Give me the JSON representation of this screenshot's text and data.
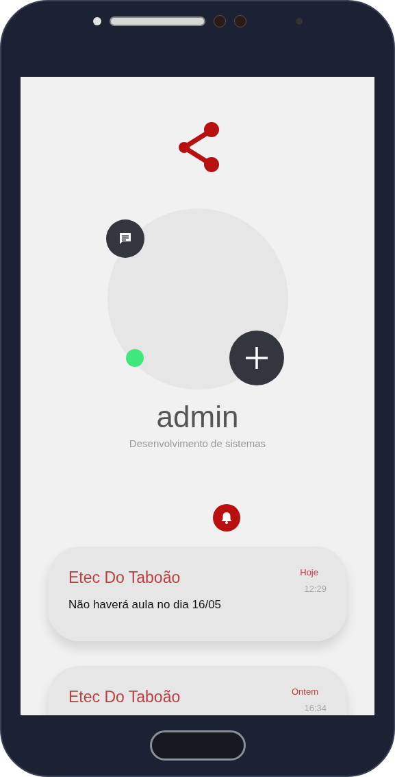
{
  "profile": {
    "name": "admin",
    "course": "Desenvolvimento de sistemas",
    "online": true
  },
  "notifications": [
    {
      "sender": "Etec Do Taboão",
      "day": "Hoje",
      "time": "12:29",
      "message": "Não haverá aula no dia 16/05"
    },
    {
      "sender": "Etec Do Taboão",
      "day": "Ontem",
      "time": "16:34"
    }
  ]
}
